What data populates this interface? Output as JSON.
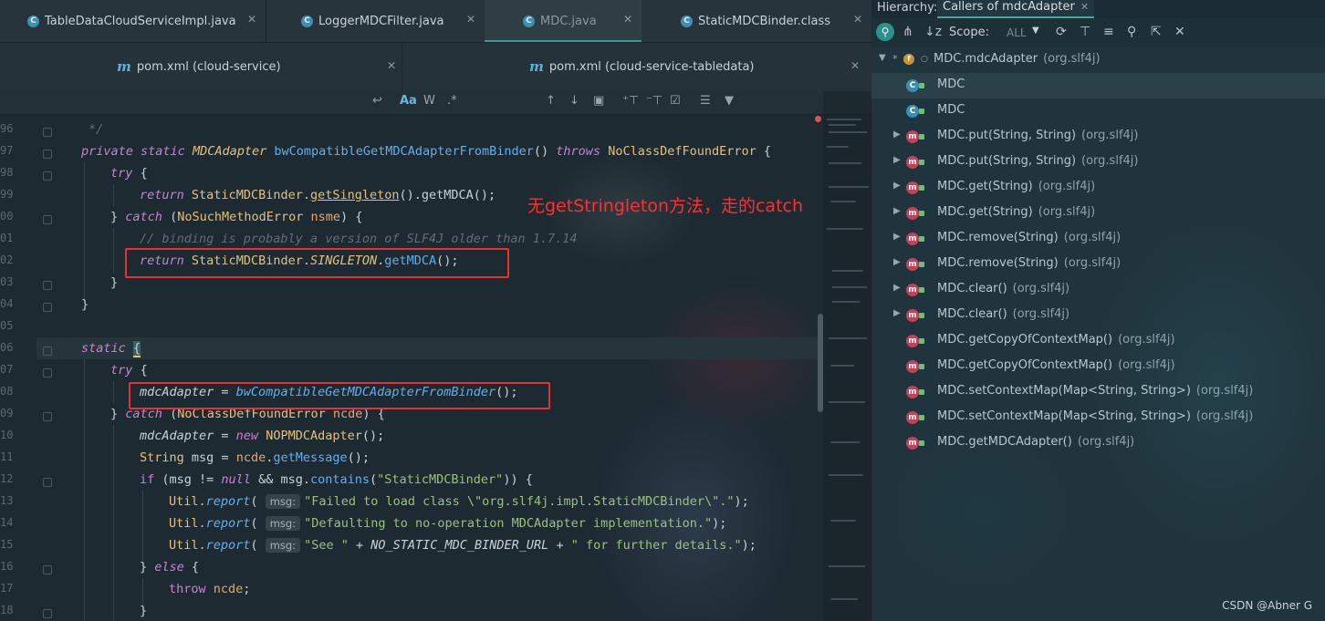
{
  "editor": {
    "file_tabs": [
      {
        "label": "TableDataCloudServiceImpl.java",
        "active": false
      },
      {
        "label": "LoggerMDCFilter.java",
        "active": false
      },
      {
        "label": "MDC.java",
        "active": true
      },
      {
        "label": "StaticMDCBinder.class",
        "active": false
      }
    ],
    "split_tabs": [
      {
        "label": "pom.xml (cloud-service)"
      },
      {
        "label": "pom.xml (cloud-service-tabledata)"
      }
    ],
    "findbar": {
      "match_case": "Aa",
      "words": "W",
      "regex": ".*"
    },
    "line_numbers": [
      "96",
      "97",
      "98",
      "99",
      "00",
      "01",
      "02",
      "03",
      "04",
      "05",
      "06",
      "07",
      "08",
      "09",
      "10",
      "11",
      "12",
      "13",
      "14",
      "15",
      "16",
      "17",
      "18"
    ],
    "code": {
      "l96": "*/",
      "l97_kw1": "private",
      "l97_kw2": "static",
      "l97_type": "MDCAdapter",
      "l97_fn": "bwCompatibleGetMDCAdapterFromBinder",
      "l97_p": "()",
      "l97_kw3": "throws",
      "l97_exc": "NoClassDefFoundError",
      "l97_b": "{",
      "l98_kw": "try",
      "l98_b": "{",
      "l99_kw": "return",
      "l99_cls": "StaticMDCBinder.",
      "l99_fn1": "getSingleton",
      "l99_mid": "().getMDCA();",
      "l00_b": "}",
      "l00_kw": "catch",
      "l00_p1": "(",
      "l00_exc": "NoSuchMethodError",
      "l00_var": "nsme",
      "l00_p2": ") {",
      "l01_cm": "// binding is probably a version of SLF4J older than 1.7.14",
      "l02_kw": "return",
      "l02_cls": "StaticMDCBinder.",
      "l02_fld": "SINGLETON",
      "l02_dot": ".",
      "l02_fn": "getMDCA",
      "l02_end": "();",
      "l03_b": "}",
      "l04_b": "}",
      "l06_kw": "static",
      "l06_b": "{",
      "l07_kw": "try",
      "l07_b": "{",
      "l08_var": "mdcAdapter",
      "l08_eq": " = ",
      "l08_fn": "bwCompatibleGetMDCAdapterFromBinder",
      "l08_end": "();",
      "l09_b": "}",
      "l09_kw": "catch",
      "l09_p1": "(",
      "l09_exc": "NoClassDefFoundError",
      "l09_var": "ncde",
      "l09_p2": ") {",
      "l10_var": "mdcAdapter",
      "l10_eq": " = ",
      "l10_kw": "new",
      "l10_cls": "NOPMDCAdapter",
      "l10_end": "();",
      "l11_type": "String",
      "l11_var": "msg",
      "l11_eq": " = ",
      "l11_ncde": "ncde",
      "l11_dot": ".",
      "l11_fn": "getMessage",
      "l11_end": "();",
      "l12_kw": "if",
      "l12_a": " (msg != ",
      "l12_null": "null",
      "l12_b": " && msg.",
      "l12_fn": "contains",
      "l12_c": "(",
      "l12_str": "\"StaticMDCBinder\"",
      "l12_d": ")) {",
      "l13_cls": "Util.",
      "l13_fn": "report",
      "l13_p": "(",
      "hint_msg": "msg:",
      "l13_str": "\"Failed to load class \\\"org.slf4j.impl.StaticMDCBinder\\\".\"",
      "l13_end": ");",
      "l14_cls": "Util.",
      "l14_fn": "report",
      "l14_p": "(",
      "l14_str": "\"Defaulting to no-operation MDCAdapter implementation.\"",
      "l14_end": ");",
      "l15_cls": "Util.",
      "l15_fn": "report",
      "l15_p": "(",
      "l15_str1": "\"See \"",
      "l15_plus1": " + ",
      "l15_const": "NO_STATIC_MDC_BINDER_URL",
      "l15_plus2": " + ",
      "l15_str2": "\" for further details.\"",
      "l15_end": ");",
      "l16_b1": "} ",
      "l16_kw": "else",
      "l16_b2": " {",
      "l17_kw": "throw",
      "l17_var": "ncde",
      "l17_end": ";",
      "l18_b": "}"
    },
    "annotation": "无getStringleton方法，走的catch"
  },
  "hierarchy": {
    "label": "Hierarchy:",
    "tab": "Callers of mdcAdapter",
    "scope_label": "Scope:",
    "scope_value": "ALL",
    "root": {
      "name": "MDC.mdcAdapter",
      "pkg": "(org.slf4j)"
    },
    "items": [
      {
        "name": "MDC",
        "pkg": "",
        "kind": "class",
        "expandable": false,
        "selected": true
      },
      {
        "name": "MDC",
        "pkg": "",
        "kind": "class",
        "expandable": false,
        "selected": false
      },
      {
        "name": "MDC.put(String, String)",
        "pkg": "(org.slf4j)",
        "kind": "method",
        "expandable": true
      },
      {
        "name": "MDC.put(String, String)",
        "pkg": "(org.slf4j)",
        "kind": "method",
        "expandable": true
      },
      {
        "name": "MDC.get(String)",
        "pkg": "(org.slf4j)",
        "kind": "method",
        "expandable": true
      },
      {
        "name": "MDC.get(String)",
        "pkg": "(org.slf4j)",
        "kind": "method",
        "expandable": true
      },
      {
        "name": "MDC.remove(String)",
        "pkg": "(org.slf4j)",
        "kind": "method",
        "expandable": true
      },
      {
        "name": "MDC.remove(String)",
        "pkg": "(org.slf4j)",
        "kind": "method",
        "expandable": true
      },
      {
        "name": "MDC.clear()",
        "pkg": "(org.slf4j)",
        "kind": "method",
        "expandable": true
      },
      {
        "name": "MDC.clear()",
        "pkg": "(org.slf4j)",
        "kind": "method",
        "expandable": true
      },
      {
        "name": "MDC.getCopyOfContextMap()",
        "pkg": "(org.slf4j)",
        "kind": "method",
        "expandable": false
      },
      {
        "name": "MDC.getCopyOfContextMap()",
        "pkg": "(org.slf4j)",
        "kind": "method",
        "expandable": false
      },
      {
        "name": "MDC.setContextMap(Map<String, String>)",
        "pkg": "(org.slf4j)",
        "kind": "method",
        "expandable": false
      },
      {
        "name": "MDC.setContextMap(Map<String, String>)",
        "pkg": "(org.slf4j)",
        "kind": "method",
        "expandable": false
      },
      {
        "name": "MDC.getMDCAdapter()",
        "pkg": "(org.slf4j)",
        "kind": "method",
        "expandable": false
      }
    ],
    "watermark": "CSDN @Abner G"
  }
}
